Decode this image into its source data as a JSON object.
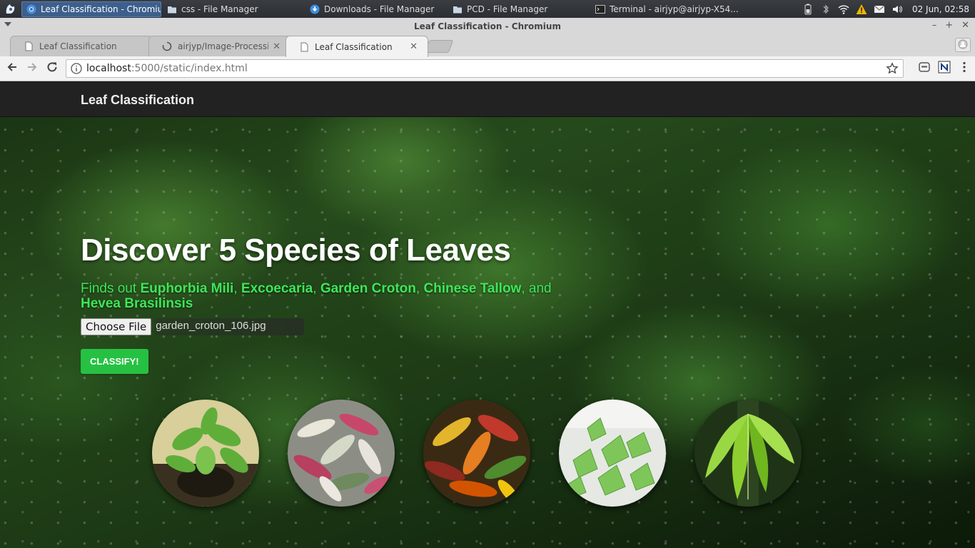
{
  "taskbar": {
    "tasks": [
      {
        "label": "Leaf Classification - Chromium",
        "icon": "chromium-icon",
        "active": true
      },
      {
        "label": "css - File Manager",
        "icon": "folder-icon",
        "active": false
      },
      {
        "label": "Downloads - File Manager",
        "icon": "download-icon",
        "active": false
      },
      {
        "label": "PCD - File Manager",
        "icon": "folder-icon",
        "active": false
      },
      {
        "label": "Terminal - airjyp@airjyp-X54...",
        "icon": "terminal-icon",
        "active": false
      }
    ],
    "clock": "02 Jun, 02:58"
  },
  "window": {
    "title": "Leaf Classification - Chromium"
  },
  "tabs": [
    {
      "title": "Leaf Classification",
      "active": false,
      "loading": false
    },
    {
      "title": "airjyp/Image-Processin",
      "active": false,
      "loading": true
    },
    {
      "title": "Leaf Classification",
      "active": true,
      "loading": false
    }
  ],
  "omnibox": {
    "host": "localhost",
    "path": ":5000/static/index.html"
  },
  "page": {
    "brand": "Leaf Classification",
    "hero_title": "Discover 5 Species of Leaves",
    "sub_prefix": "Finds out ",
    "species": [
      "Euphorbia Mili",
      "Excoecaria",
      "Garden Croton",
      "Chinese Tallow",
      "Hevea Brasilinsis"
    ],
    "sub_and": "and",
    "choose_file_label": "Choose File",
    "file_name": "garden_croton_106.jpg",
    "classify_label": "CLASSIFY!",
    "leaf_images": [
      "euphorbia-mili-image",
      "excoecaria-image",
      "garden-croton-image",
      "chinese-tallow-image",
      "hevea-brasilinsis-image"
    ]
  },
  "colors": {
    "accent_green": "#26c143",
    "subtitle_green": "#3ee65a",
    "navbar": "#222222"
  }
}
